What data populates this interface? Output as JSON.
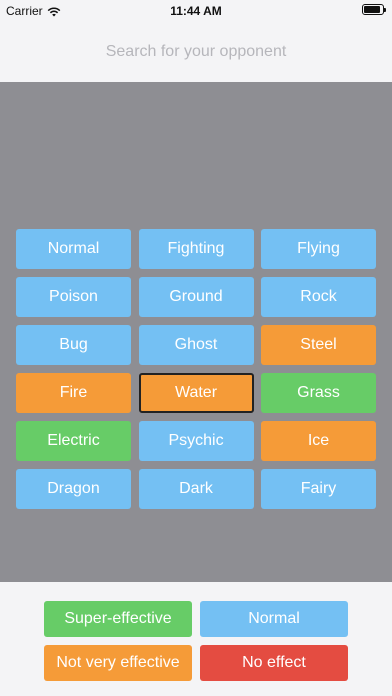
{
  "status_bar": {
    "carrier": "Carrier",
    "time": "11:44 AM",
    "icons": [
      "wifi-icon",
      "battery-icon"
    ],
    "battery_level": 0.9
  },
  "search": {
    "placeholder": "Search for your opponent",
    "value": ""
  },
  "types": [
    {
      "label": "Normal",
      "color": "#74c0f3"
    },
    {
      "label": "Fighting",
      "color": "#74c0f3"
    },
    {
      "label": "Flying",
      "color": "#74c0f3"
    },
    {
      "label": "Poison",
      "color": "#74c0f3"
    },
    {
      "label": "Ground",
      "color": "#74c0f3"
    },
    {
      "label": "Rock",
      "color": "#74c0f3"
    },
    {
      "label": "Bug",
      "color": "#74c0f3"
    },
    {
      "label": "Ghost",
      "color": "#74c0f3"
    },
    {
      "label": "Steel",
      "color": "#f59b38"
    },
    {
      "label": "Fire",
      "color": "#f59b38"
    },
    {
      "label": "Water",
      "color": "#f59b38",
      "selected": true
    },
    {
      "label": "Grass",
      "color": "#67cc67"
    },
    {
      "label": "Electric",
      "color": "#67cc67"
    },
    {
      "label": "Psychic",
      "color": "#74c0f3"
    },
    {
      "label": "Ice",
      "color": "#f59b38"
    },
    {
      "label": "Dragon",
      "color": "#74c0f3"
    },
    {
      "label": "Dark",
      "color": "#74c0f3"
    },
    {
      "label": "Fairy",
      "color": "#74c0f3"
    }
  ],
  "legend": {
    "super_effective": {
      "label": "Super-effective",
      "color": "#67cc67"
    },
    "normal": {
      "label": "Normal",
      "color": "#74c0f3"
    },
    "not_very_effective": {
      "label": "Not very effective",
      "color": "#f59b38"
    },
    "no_effect": {
      "label": "No effect",
      "color": "#e44c41"
    }
  },
  "colors": {
    "background": "#f4f4f6",
    "grid_background": "#8e8e93",
    "selected_border": "#222222"
  }
}
